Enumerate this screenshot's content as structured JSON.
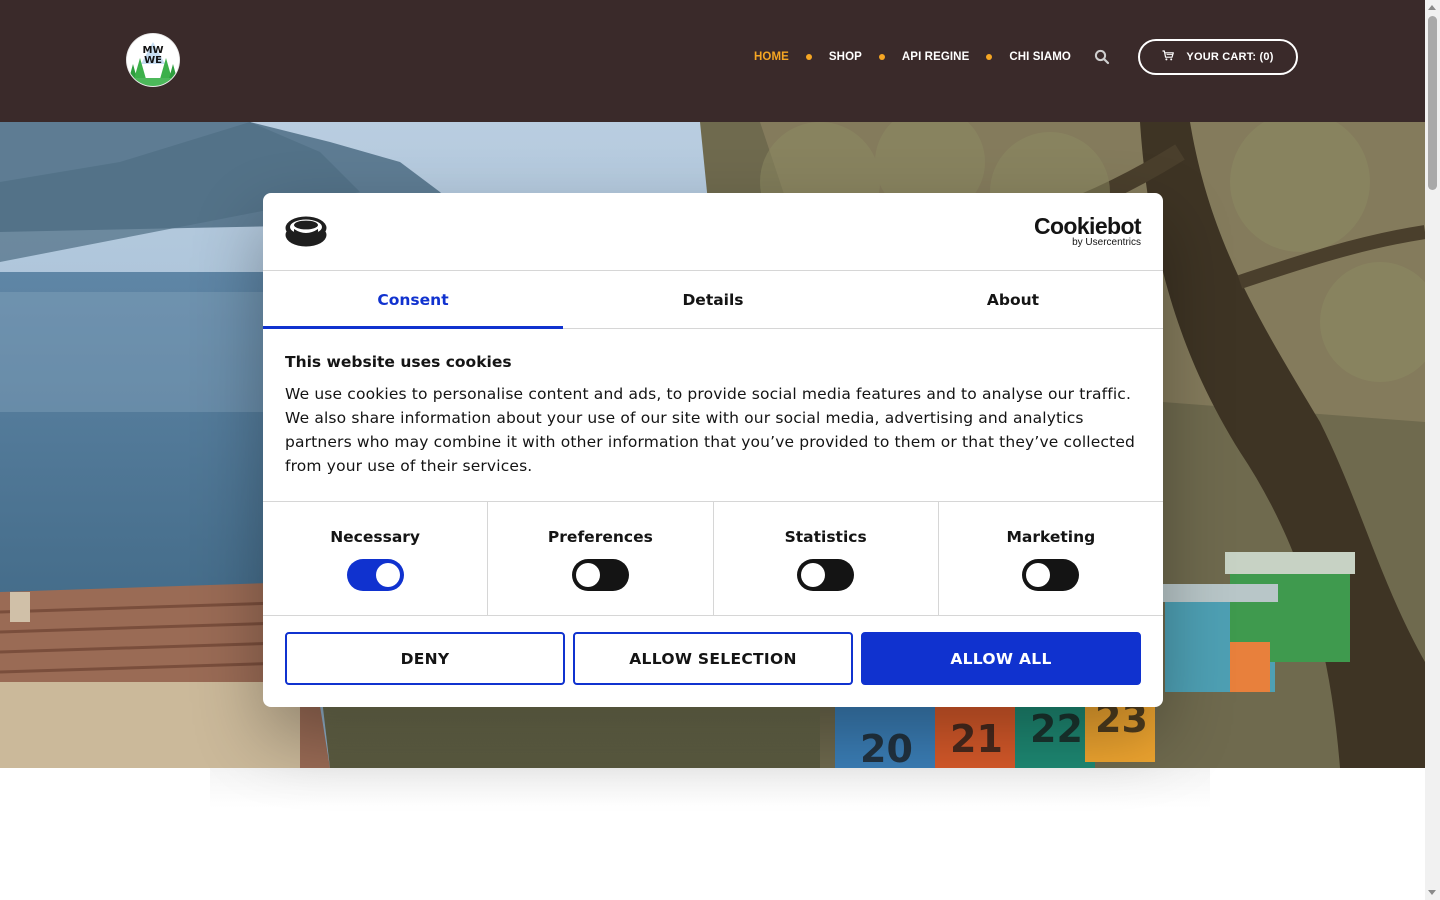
{
  "header": {
    "logo_text": "MWE",
    "nav": [
      {
        "label": "HOME",
        "active": true
      },
      {
        "label": "SHOP",
        "active": false
      },
      {
        "label": "API REGINE",
        "active": false
      },
      {
        "label": "CHI SIAMO",
        "active": false
      }
    ],
    "search_icon": "search-icon",
    "cart_label": "YOUR CART: (0)",
    "cart_icon": "cart-icon"
  },
  "colors": {
    "header_bg": "#3a2a2a",
    "nav_accent": "#f5a623",
    "cookiebot_blue": "#1032cf"
  },
  "cookie_dialog": {
    "brand_name": "Cookiebot",
    "brand_sub": "by Usercentrics",
    "tabs": [
      {
        "label": "Consent",
        "active": true
      },
      {
        "label": "Details",
        "active": false
      },
      {
        "label": "About",
        "active": false
      }
    ],
    "heading": "This website uses cookies",
    "body": "We use cookies to personalise content and ads, to provide social media features and to analyse our traffic. We also share information about your use of our site with our social media, advertising and analytics partners who may combine it with other information that you’ve provided to them or that they’ve collected from your use of their services.",
    "toggles": [
      {
        "label": "Necessary",
        "on": true
      },
      {
        "label": "Preferences",
        "on": false
      },
      {
        "label": "Statistics",
        "on": false
      },
      {
        "label": "Marketing",
        "on": false
      }
    ],
    "buttons": {
      "deny": "DENY",
      "allow_selection": "ALLOW SELECTION",
      "allow_all": "ALLOW ALL"
    }
  }
}
